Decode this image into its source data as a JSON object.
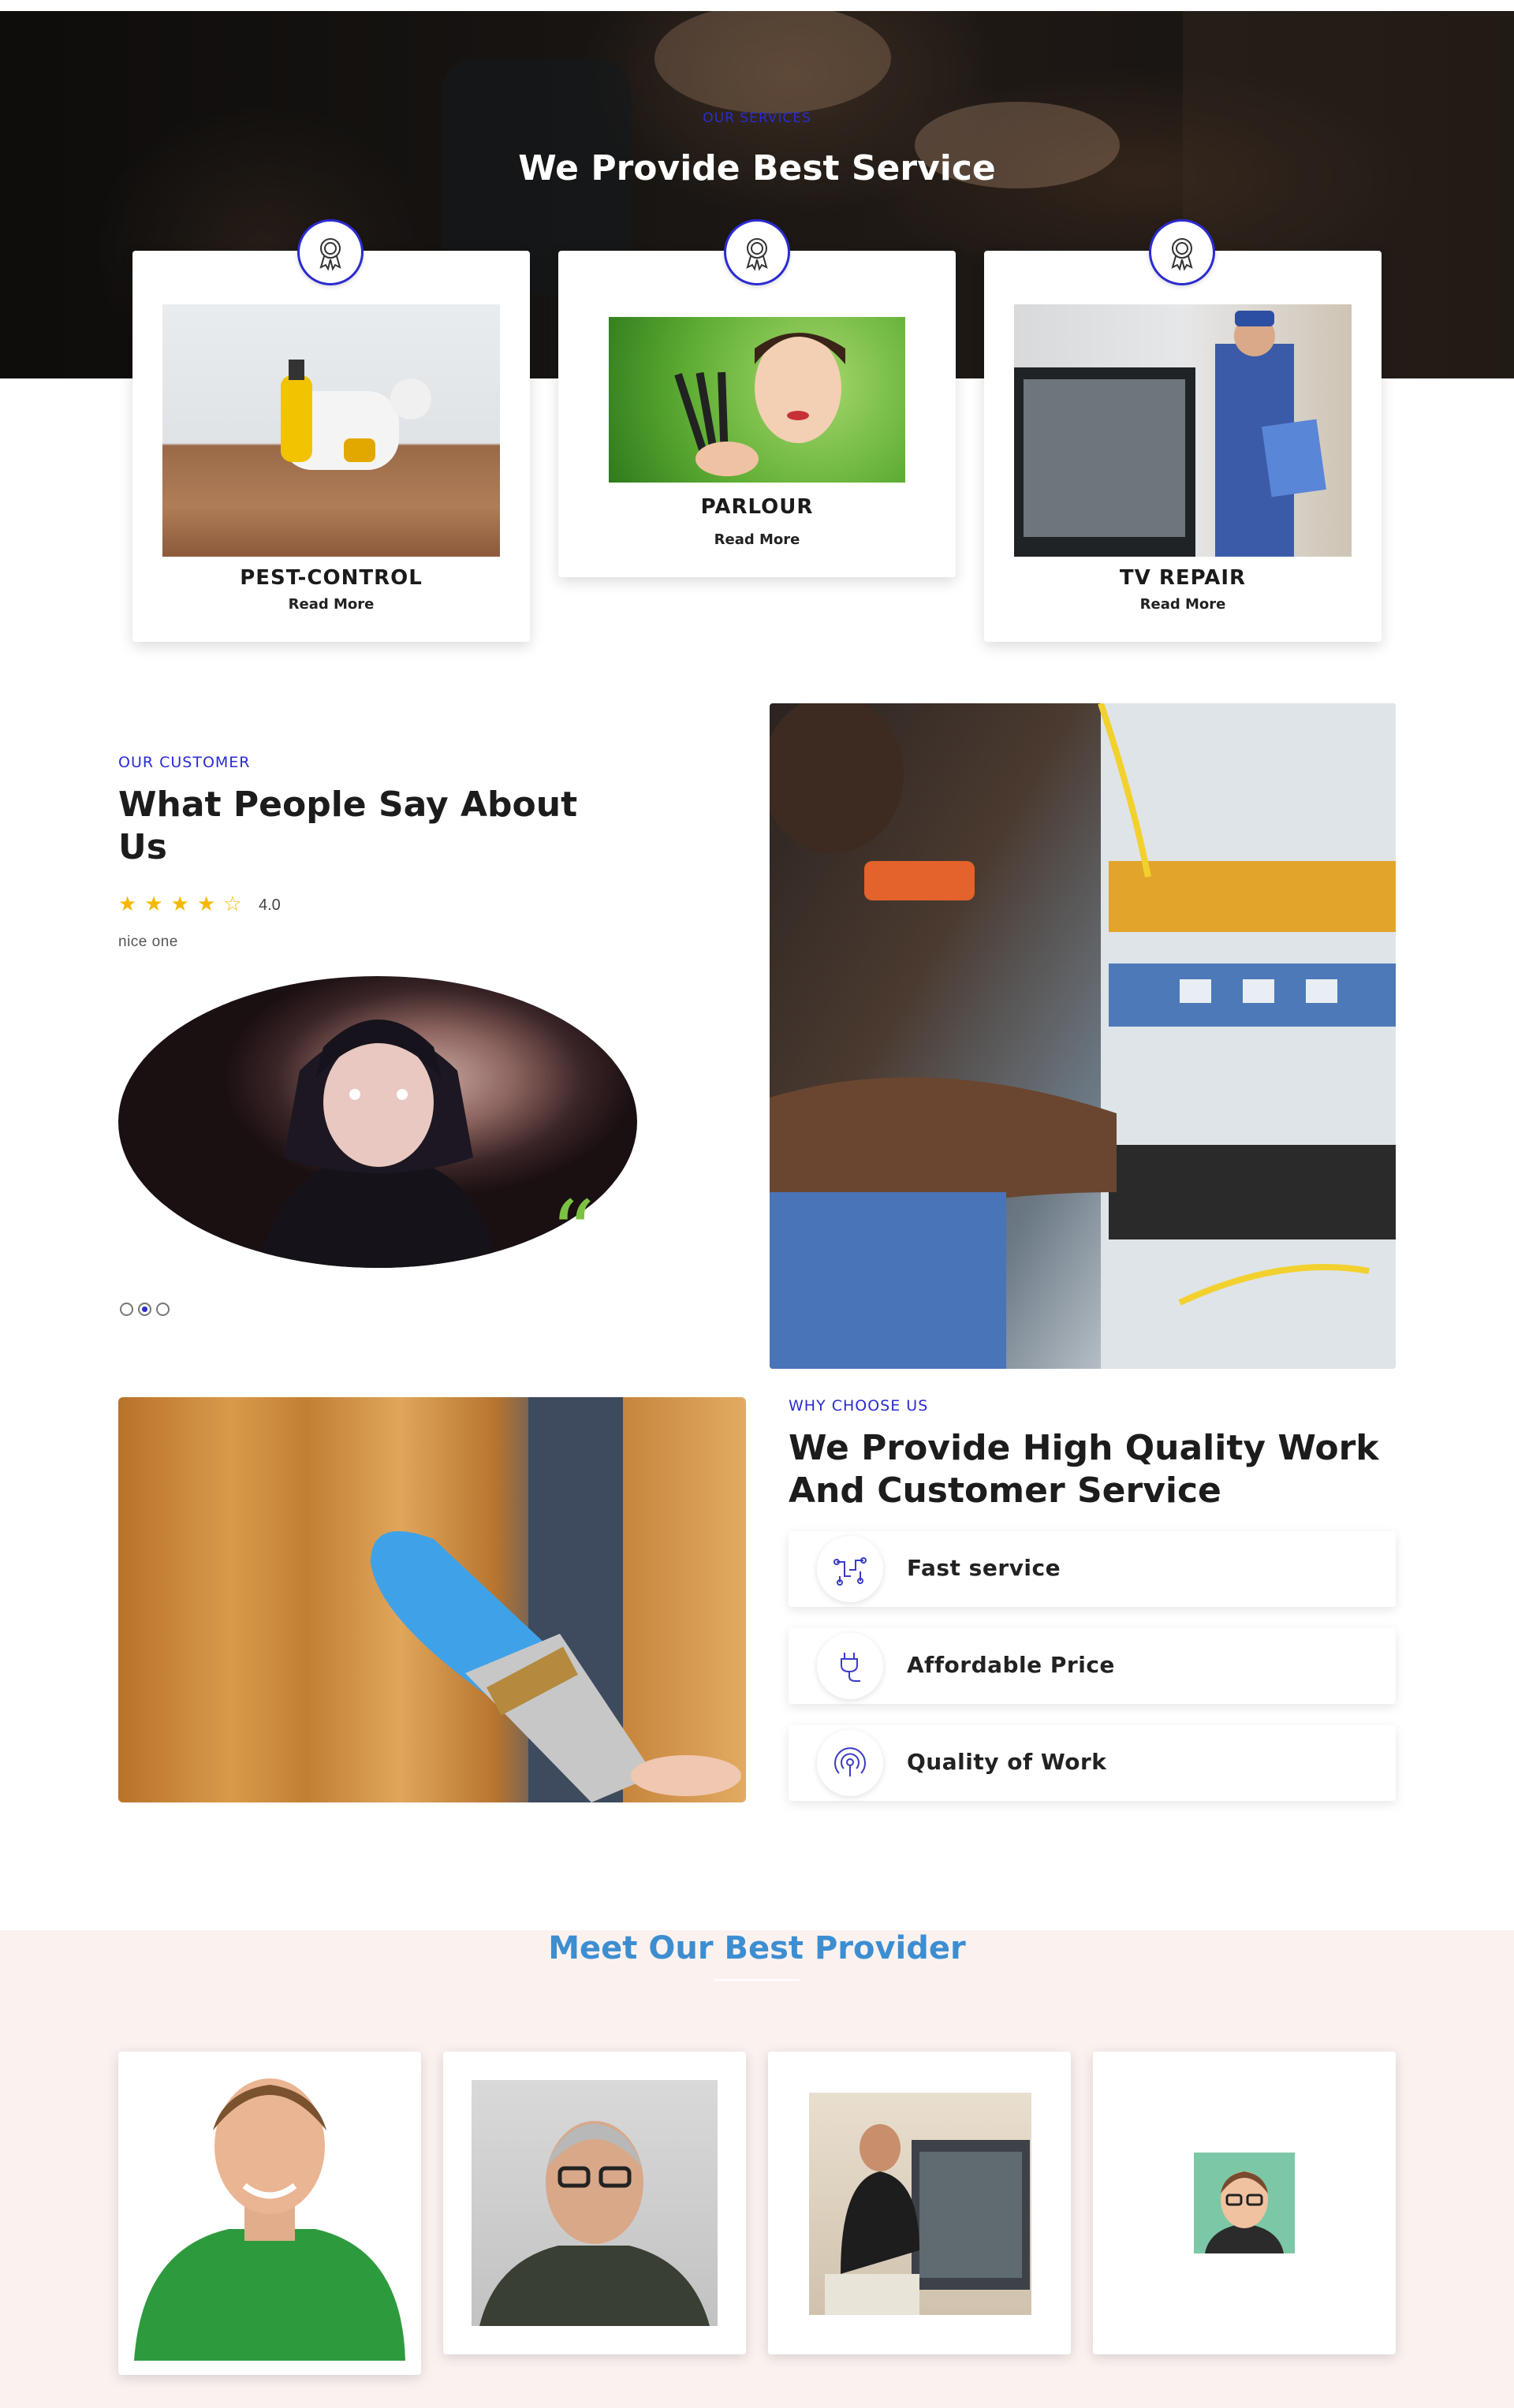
{
  "services_section": {
    "eyebrow": "OUR SERVICES",
    "title": "We Provide Best Service",
    "cards": [
      {
        "name": "PEST-CONTROL",
        "link": "Read More"
      },
      {
        "name": "PARLOUR",
        "link": "Read More"
      },
      {
        "name": "TV REPAIR",
        "link": "Read More"
      }
    ],
    "badge_icon": "award-ribbon-icon",
    "accent_color": "#2b2bd1"
  },
  "testimonial": {
    "eyebrow": "OUR CUSTOMER",
    "title_line1": "What People Say About",
    "title_line2": "Us",
    "rating_value": 4,
    "rating_max": 5,
    "rating_text": "4.0",
    "review": "nice one",
    "quote_icon": "quote-icon",
    "slides_total": 3,
    "active_slide": 2,
    "star_color": "#f5b800",
    "quote_color": "#7cc242"
  },
  "why_choose": {
    "eyebrow": "WHY CHOOSE US",
    "title_line1": "We Provide High Quality Work",
    "title_line2": "And Customer Service",
    "features": [
      {
        "label": "Fast service",
        "icon": "circuit-icon"
      },
      {
        "label": "Affordable Price",
        "icon": "plug-icon"
      },
      {
        "label": "Quality of Work",
        "icon": "broadcast-icon"
      }
    ]
  },
  "providers": {
    "title": "Meet Our Best Provider",
    "title_color": "#3d8ed1",
    "band_color": "#fbf2f0",
    "count": 4
  }
}
